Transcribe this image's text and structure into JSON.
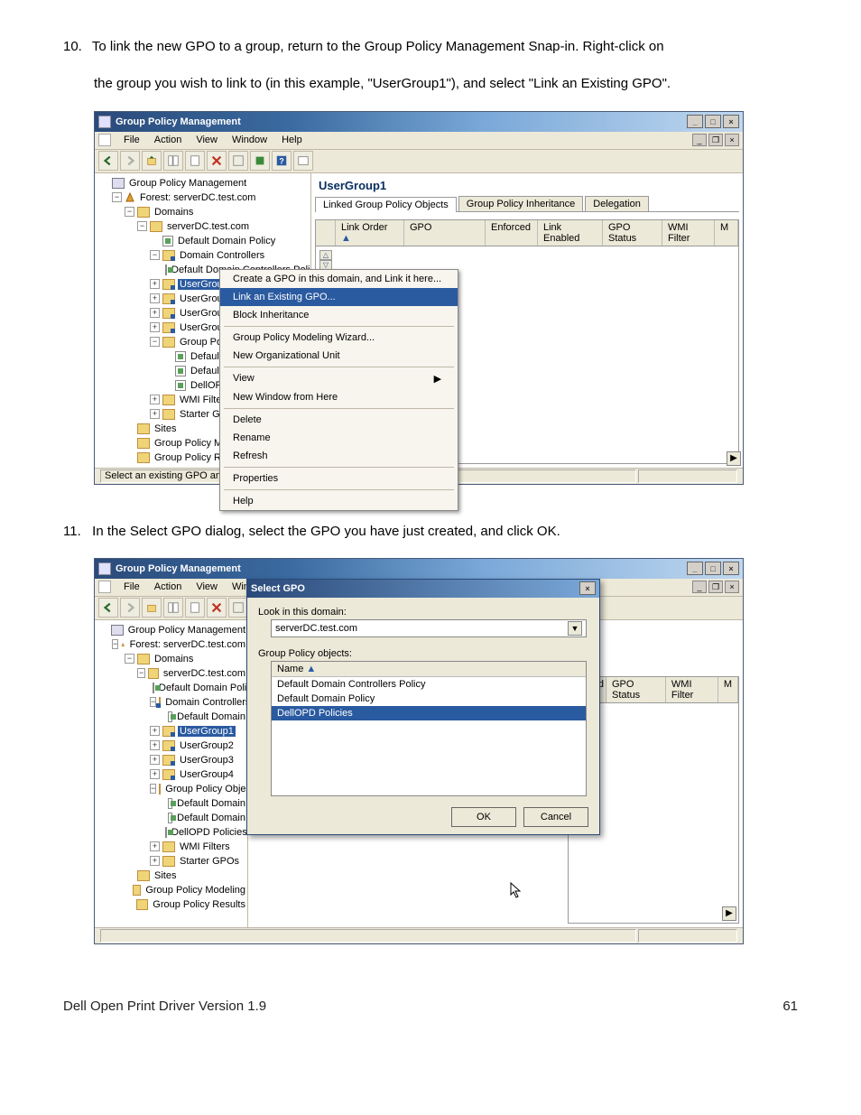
{
  "step10": {
    "number": "10.",
    "text_a": "To link the new GPO to a group, return to the Group Policy Management Snap-in.  Right-click on",
    "text_b": "the group you wish to link to (in this example, \"UserGroup1\"), and select \"Link an Existing GPO\"."
  },
  "step11": {
    "number": "11.",
    "text": "In the Select GPO dialog, select the GPO you have just created, and click OK."
  },
  "window": {
    "title": "Group Policy Management",
    "menus": [
      "File",
      "Action",
      "View",
      "Window",
      "Help"
    ],
    "status": "Select an existing GPO and link it to this container"
  },
  "tree": {
    "root": "Group Policy Management",
    "forest": "Forest: serverDC.test.com",
    "domains": "Domains",
    "domain": "serverDC.test.com",
    "ddp": "Default Domain Policy",
    "dc": "Domain Controllers",
    "ddcp": "Default Domain Controllers Policy",
    "ug1": "UserGroup1",
    "ug2": "UserGroup2",
    "ug3": "UserGroup3",
    "ug4": "UserGroup4",
    "gpo_folder_a": "Group Policy",
    "gpo_folder_b": "Group Policy Object",
    "def_a": "Default I",
    "def_b": "Default I",
    "dellopd": "DellOPD",
    "def_dom1": "Default Domain",
    "def_dom2": "Default Domain",
    "dellopd_pol": "DellOPD Policies",
    "ddp_full": "Default Domain Poli",
    "dd_full": "Default Domain",
    "wmi": "WMI Filters",
    "starter": "Starter GPOs",
    "sites": "Sites",
    "gpm": "Group Policy Modeling",
    "gpr": "Group Policy Results",
    "gpm_trunc": "Group Policy Modelin",
    "gpr_trunc": "Group Policy Results"
  },
  "right_panel": {
    "title": "UserGroup1",
    "tabs": [
      "Linked Group Policy Objects",
      "Group Policy Inheritance",
      "Delegation"
    ],
    "cols": [
      "Link Order",
      "GPO",
      "Enforced",
      "Link Enabled",
      "GPO Status",
      "WMI Filter",
      "M"
    ],
    "cols2": [
      "nabled",
      "GPO Status",
      "WMI Filter",
      "M"
    ]
  },
  "context_menu": {
    "items": [
      "Create a GPO in this domain, and Link it here...",
      "Link an Existing GPO...",
      "Block Inheritance",
      "Group Policy Modeling Wizard...",
      "New Organizational Unit",
      "View",
      "New Window from Here",
      "Delete",
      "Rename",
      "Refresh",
      "Properties",
      "Help"
    ]
  },
  "dialog": {
    "title": "Select GPO",
    "look_label": "Look in this domain:",
    "look_value": "serverDC.test.com",
    "gpo_label": "Group Policy objects:",
    "list_head": "Name",
    "items": [
      "Default Domain Controllers Policy",
      "Default Domain Policy",
      "DellOPD Policies"
    ],
    "ok": "OK",
    "cancel": "Cancel"
  },
  "footer": {
    "left": "Dell Open Print Driver Version 1.9",
    "right": "61"
  }
}
